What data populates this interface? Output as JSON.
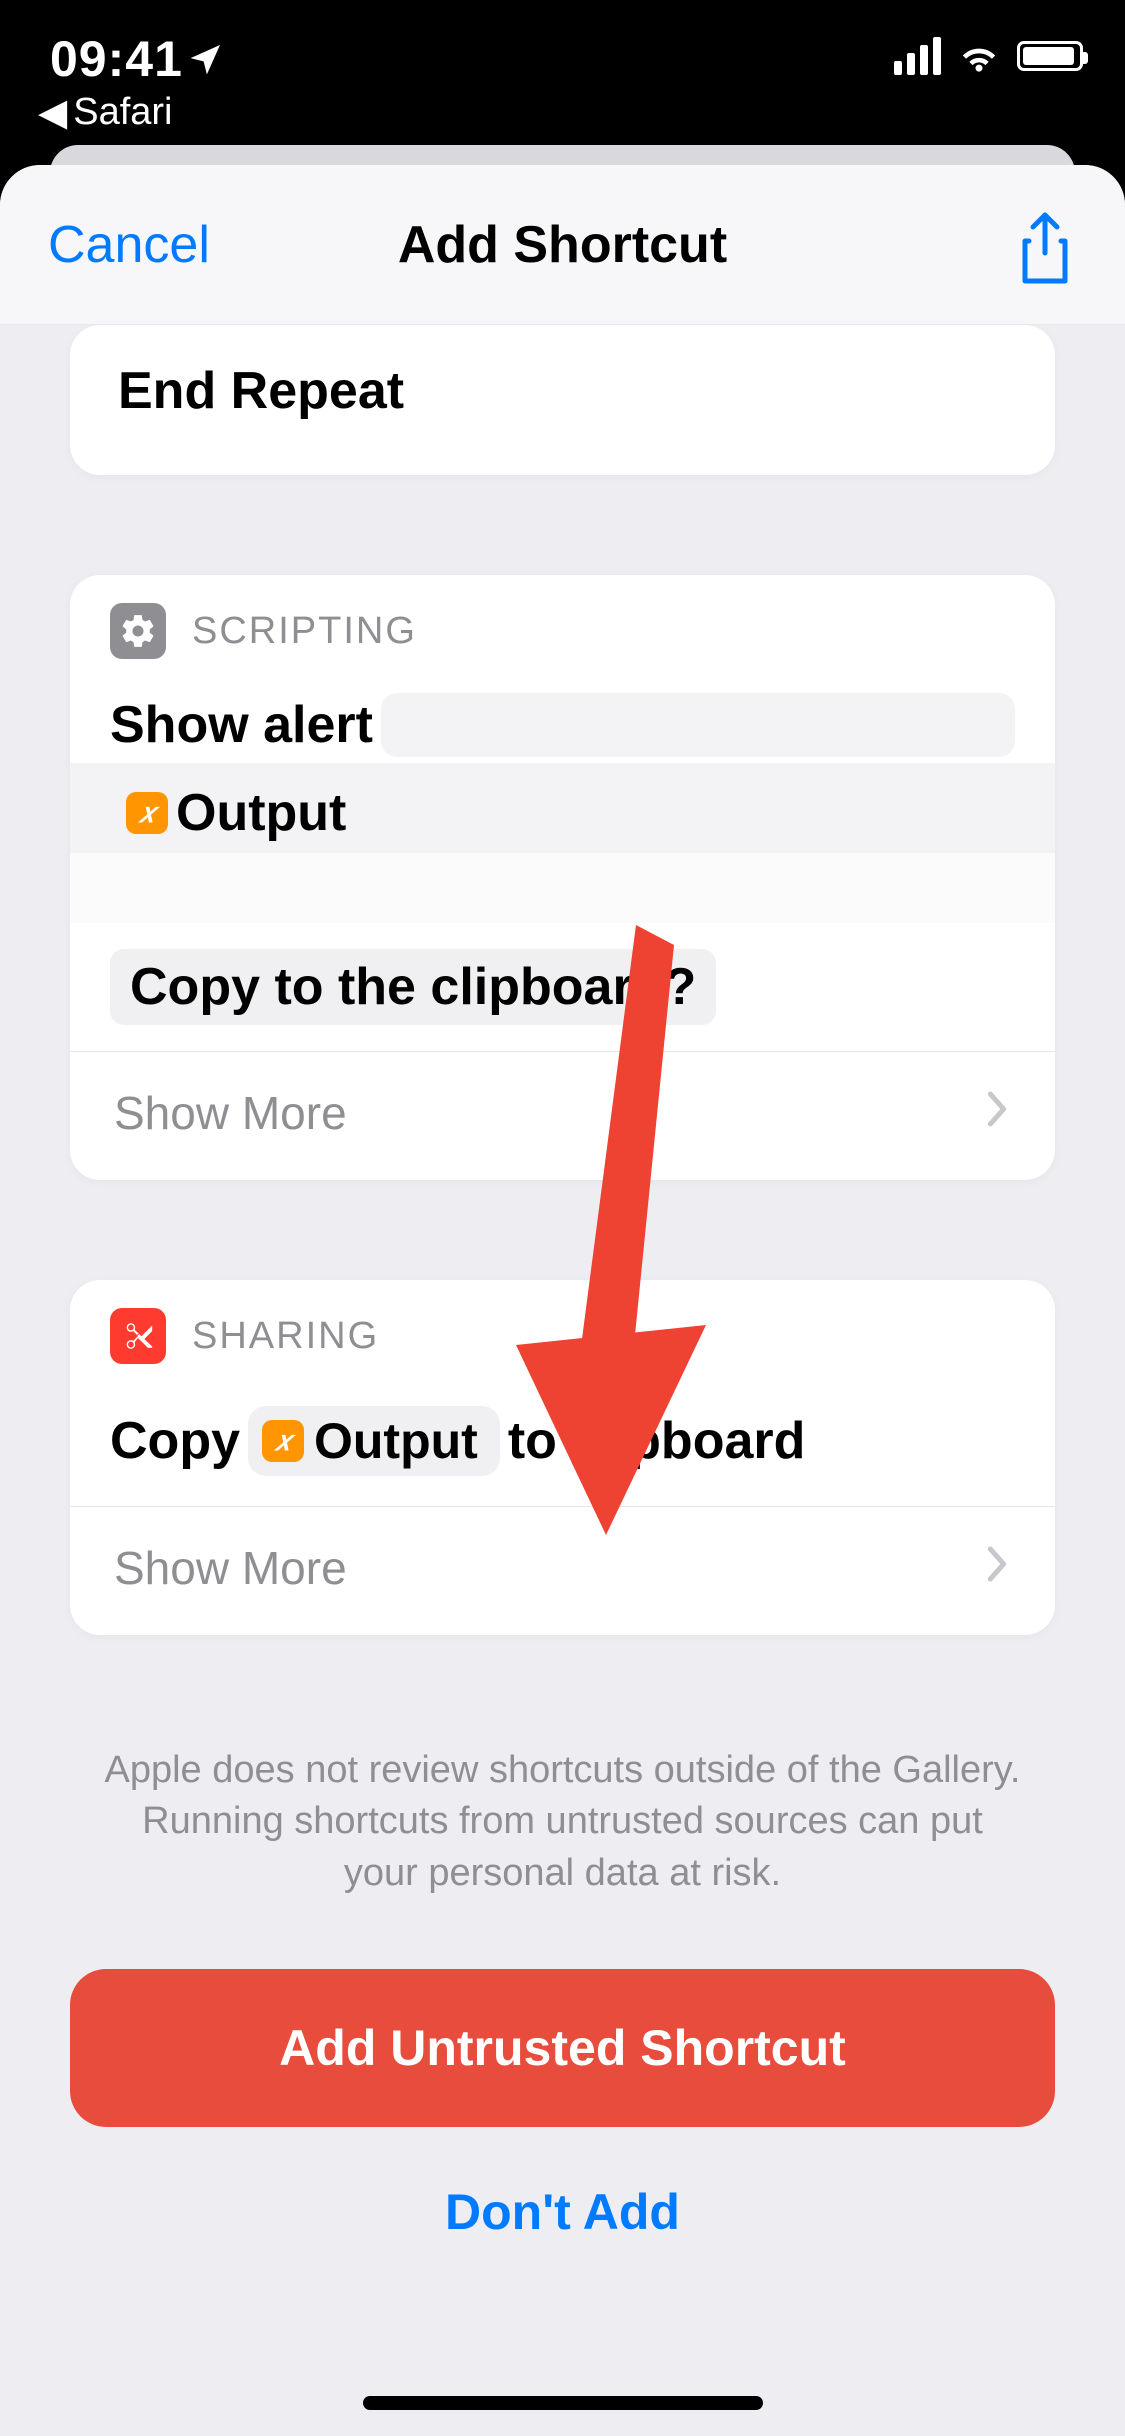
{
  "status": {
    "time": "09:41",
    "back_app": "Safari"
  },
  "modal": {
    "cancel": "Cancel",
    "title": "Add Shortcut"
  },
  "cards": {
    "end_repeat": "End Repeat",
    "scripting": {
      "category": "SCRIPTING",
      "show_alert": "Show alert",
      "output_var": "Output",
      "copy_question": "Copy to the clipboard?",
      "show_more": "Show More"
    },
    "sharing": {
      "category": "SHARING",
      "copy_prefix": "Copy",
      "output_var": "Output",
      "copy_suffix": "to clipboard",
      "show_more": "Show More"
    }
  },
  "footer": {
    "warning": "Apple does not review shortcuts outside of the Gallery. Running shortcuts from untrusted sources can put your personal data at risk.",
    "add_button": "Add Untrusted Shortcut",
    "dont_add": "Don't Add"
  }
}
